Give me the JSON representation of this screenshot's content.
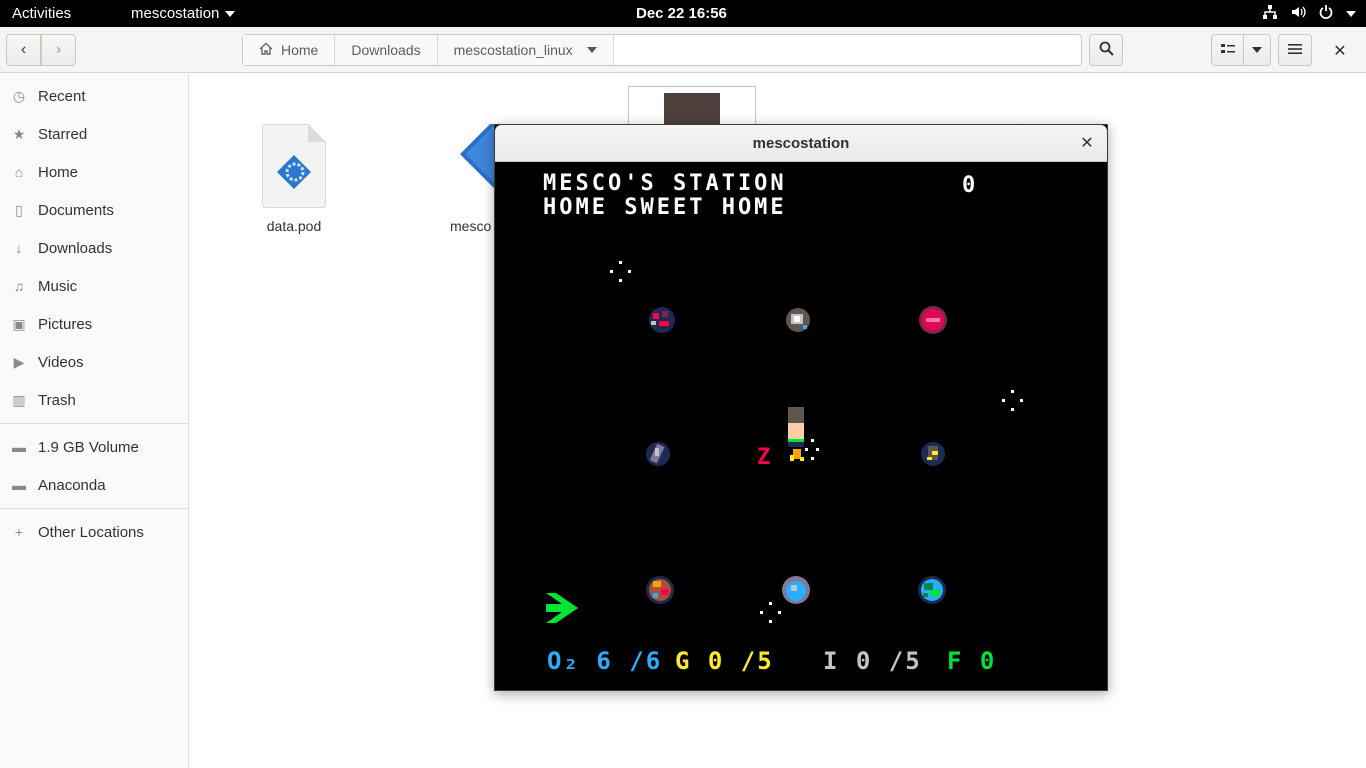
{
  "topbar": {
    "activities": "Activities",
    "app_name": "mescostation",
    "clock": "Dec 22  16:56"
  },
  "pathbar": {
    "crumbs": [
      "Home",
      "Downloads",
      "mescostation_linux"
    ]
  },
  "sidebar": {
    "items": [
      {
        "label": "Recent",
        "icon": "clock-icon"
      },
      {
        "label": "Starred",
        "icon": "star-icon"
      },
      {
        "label": "Home",
        "icon": "home-icon"
      },
      {
        "label": "Documents",
        "icon": "document-icon"
      },
      {
        "label": "Downloads",
        "icon": "download-icon"
      },
      {
        "label": "Music",
        "icon": "music-icon"
      },
      {
        "label": "Pictures",
        "icon": "camera-icon"
      },
      {
        "label": "Videos",
        "icon": "video-icon"
      },
      {
        "label": "Trash",
        "icon": "trash-icon"
      }
    ],
    "volumes": [
      {
        "label": "1.9 GB Volume",
        "icon": "drive-icon"
      },
      {
        "label": "Anaconda",
        "icon": "drive-icon"
      }
    ],
    "other": {
      "label": "Other Locations",
      "icon": "plus-icon"
    }
  },
  "files": [
    {
      "name": "data.pod"
    },
    {
      "name": "mesco"
    }
  ],
  "game_window": {
    "title": "mescostation",
    "heading_line1": "MESCO'S STATION",
    "heading_line2": "HOME SWEET HOME",
    "score": "0",
    "z_label": "Z",
    "hud": {
      "oxygen": "O₂ 6 /6",
      "gold": "G 0 /5",
      "iron": "I 0 /5",
      "food": "F 0"
    },
    "colors": {
      "oxygen": "#29adff",
      "gold": "#ffec27",
      "iron": "#c2c3c7",
      "food": "#00e436",
      "player_arrow": "#00e436"
    }
  }
}
